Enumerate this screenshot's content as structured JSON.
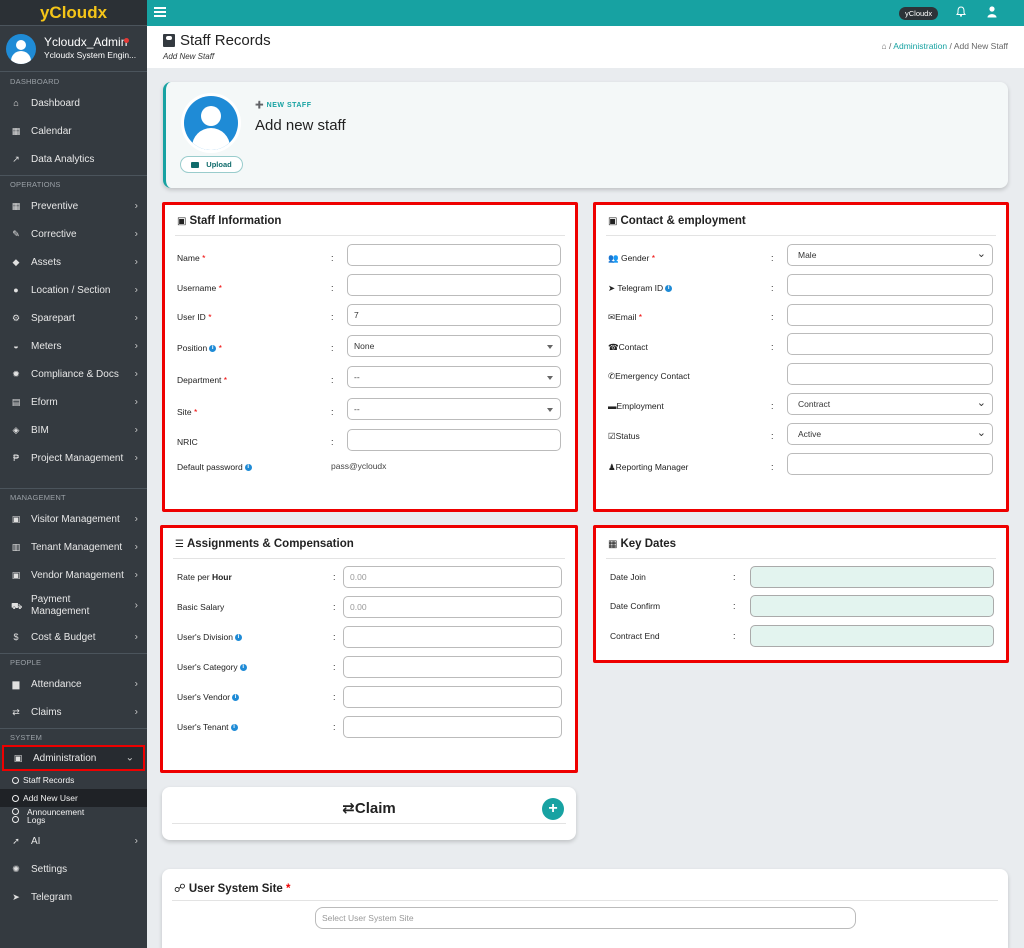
{
  "brand": "yCloudx",
  "user": {
    "name": "Ycloudx_Admin",
    "role": "Ycloudx System Engin..."
  },
  "sidebar": {
    "sections": {
      "dashboard": "DASHBOARD",
      "operations": "OPERATIONS",
      "management": "MANAGEMENT",
      "people": "PEOPLE",
      "system": "SYSTEM"
    },
    "items": {
      "dashboard": "Dashboard",
      "calendar": "Calendar",
      "data_analytics": "Data Analytics",
      "preventive": "Preventive",
      "corrective": "Corrective",
      "assets": "Assets",
      "location": "Location / Section",
      "sparepart": "Sparepart",
      "meters": "Meters",
      "compliance": "Compliance & Docs",
      "eform": "Eform",
      "bim": "BIM",
      "project_management": "Project Management",
      "visitor": "Visitor Management",
      "tenant": "Tenant Management",
      "vendor": "Vendor Management",
      "payment": "Payment Management",
      "cost_budget": "Cost & Budget",
      "attendance": "Attendance",
      "claims": "Claims",
      "administration": "Administration",
      "ai": "AI",
      "settings": "Settings",
      "telegram": "Telegram"
    },
    "submenu": {
      "staff_records": "Staff Records",
      "add_new_user": "Add New User",
      "announcement": "Announcement",
      "logs": "Logs"
    }
  },
  "topbar": {
    "pill": "yCloudx"
  },
  "header": {
    "title": "Staff Records",
    "subtitle": "Add New Staff"
  },
  "breadcrumb": {
    "admin": "Administration",
    "sep": "/",
    "current": "Add New Staff"
  },
  "new_staff": {
    "label": "NEW STAFF",
    "title": "Add new staff",
    "upload": "Upload"
  },
  "staff_info": {
    "title": "Staff Information",
    "fields": {
      "name": "Name",
      "username": "Username",
      "user_id": "User ID",
      "position": "Position",
      "department": "Department",
      "site": "Site",
      "nric": "NRIC",
      "default_password": "Default password"
    },
    "values": {
      "user_id": "7",
      "position": "None",
      "department": "--",
      "site": "--",
      "default_password": "pass@ycloudx"
    }
  },
  "contact": {
    "title": "Contact & employment",
    "fields": {
      "gender": "Gender",
      "telegram_id": "Telegram ID",
      "email": "Email",
      "contact": "Contact",
      "emergency": "Emergency Contact",
      "employment": "Employment",
      "status": "Status",
      "reporting": "Reporting Manager"
    },
    "values": {
      "gender": "Male",
      "employment": "Contract",
      "status": "Active"
    }
  },
  "assign": {
    "title": "Assignments & Compensation",
    "fields": {
      "rate_prefix": "Rate per ",
      "rate_bold": "Hour",
      "basic_salary": "Basic Salary",
      "division": "User's Division",
      "category": "User's Category",
      "vendor": "User's Vendor",
      "tenant": "User's Tenant"
    },
    "placeholders": {
      "rate": "0.00",
      "basic_salary": "0.00"
    }
  },
  "key_dates": {
    "title": "Key Dates",
    "fields": {
      "date_join": "Date Join",
      "date_confirm": "Date Confirm",
      "contract_end": "Contract End"
    }
  },
  "claim": {
    "title": "Claim",
    "plus": "+"
  },
  "user_system_site": {
    "title": "User System Site",
    "placeholder": "Select User System Site"
  },
  "common": {
    "colon": ":",
    "required": "*",
    "info": "i"
  },
  "colors": {
    "teal": "#17a2a2",
    "sidebar": "#343a40",
    "highlight": "#ee0000",
    "brand": "#f5c518"
  }
}
